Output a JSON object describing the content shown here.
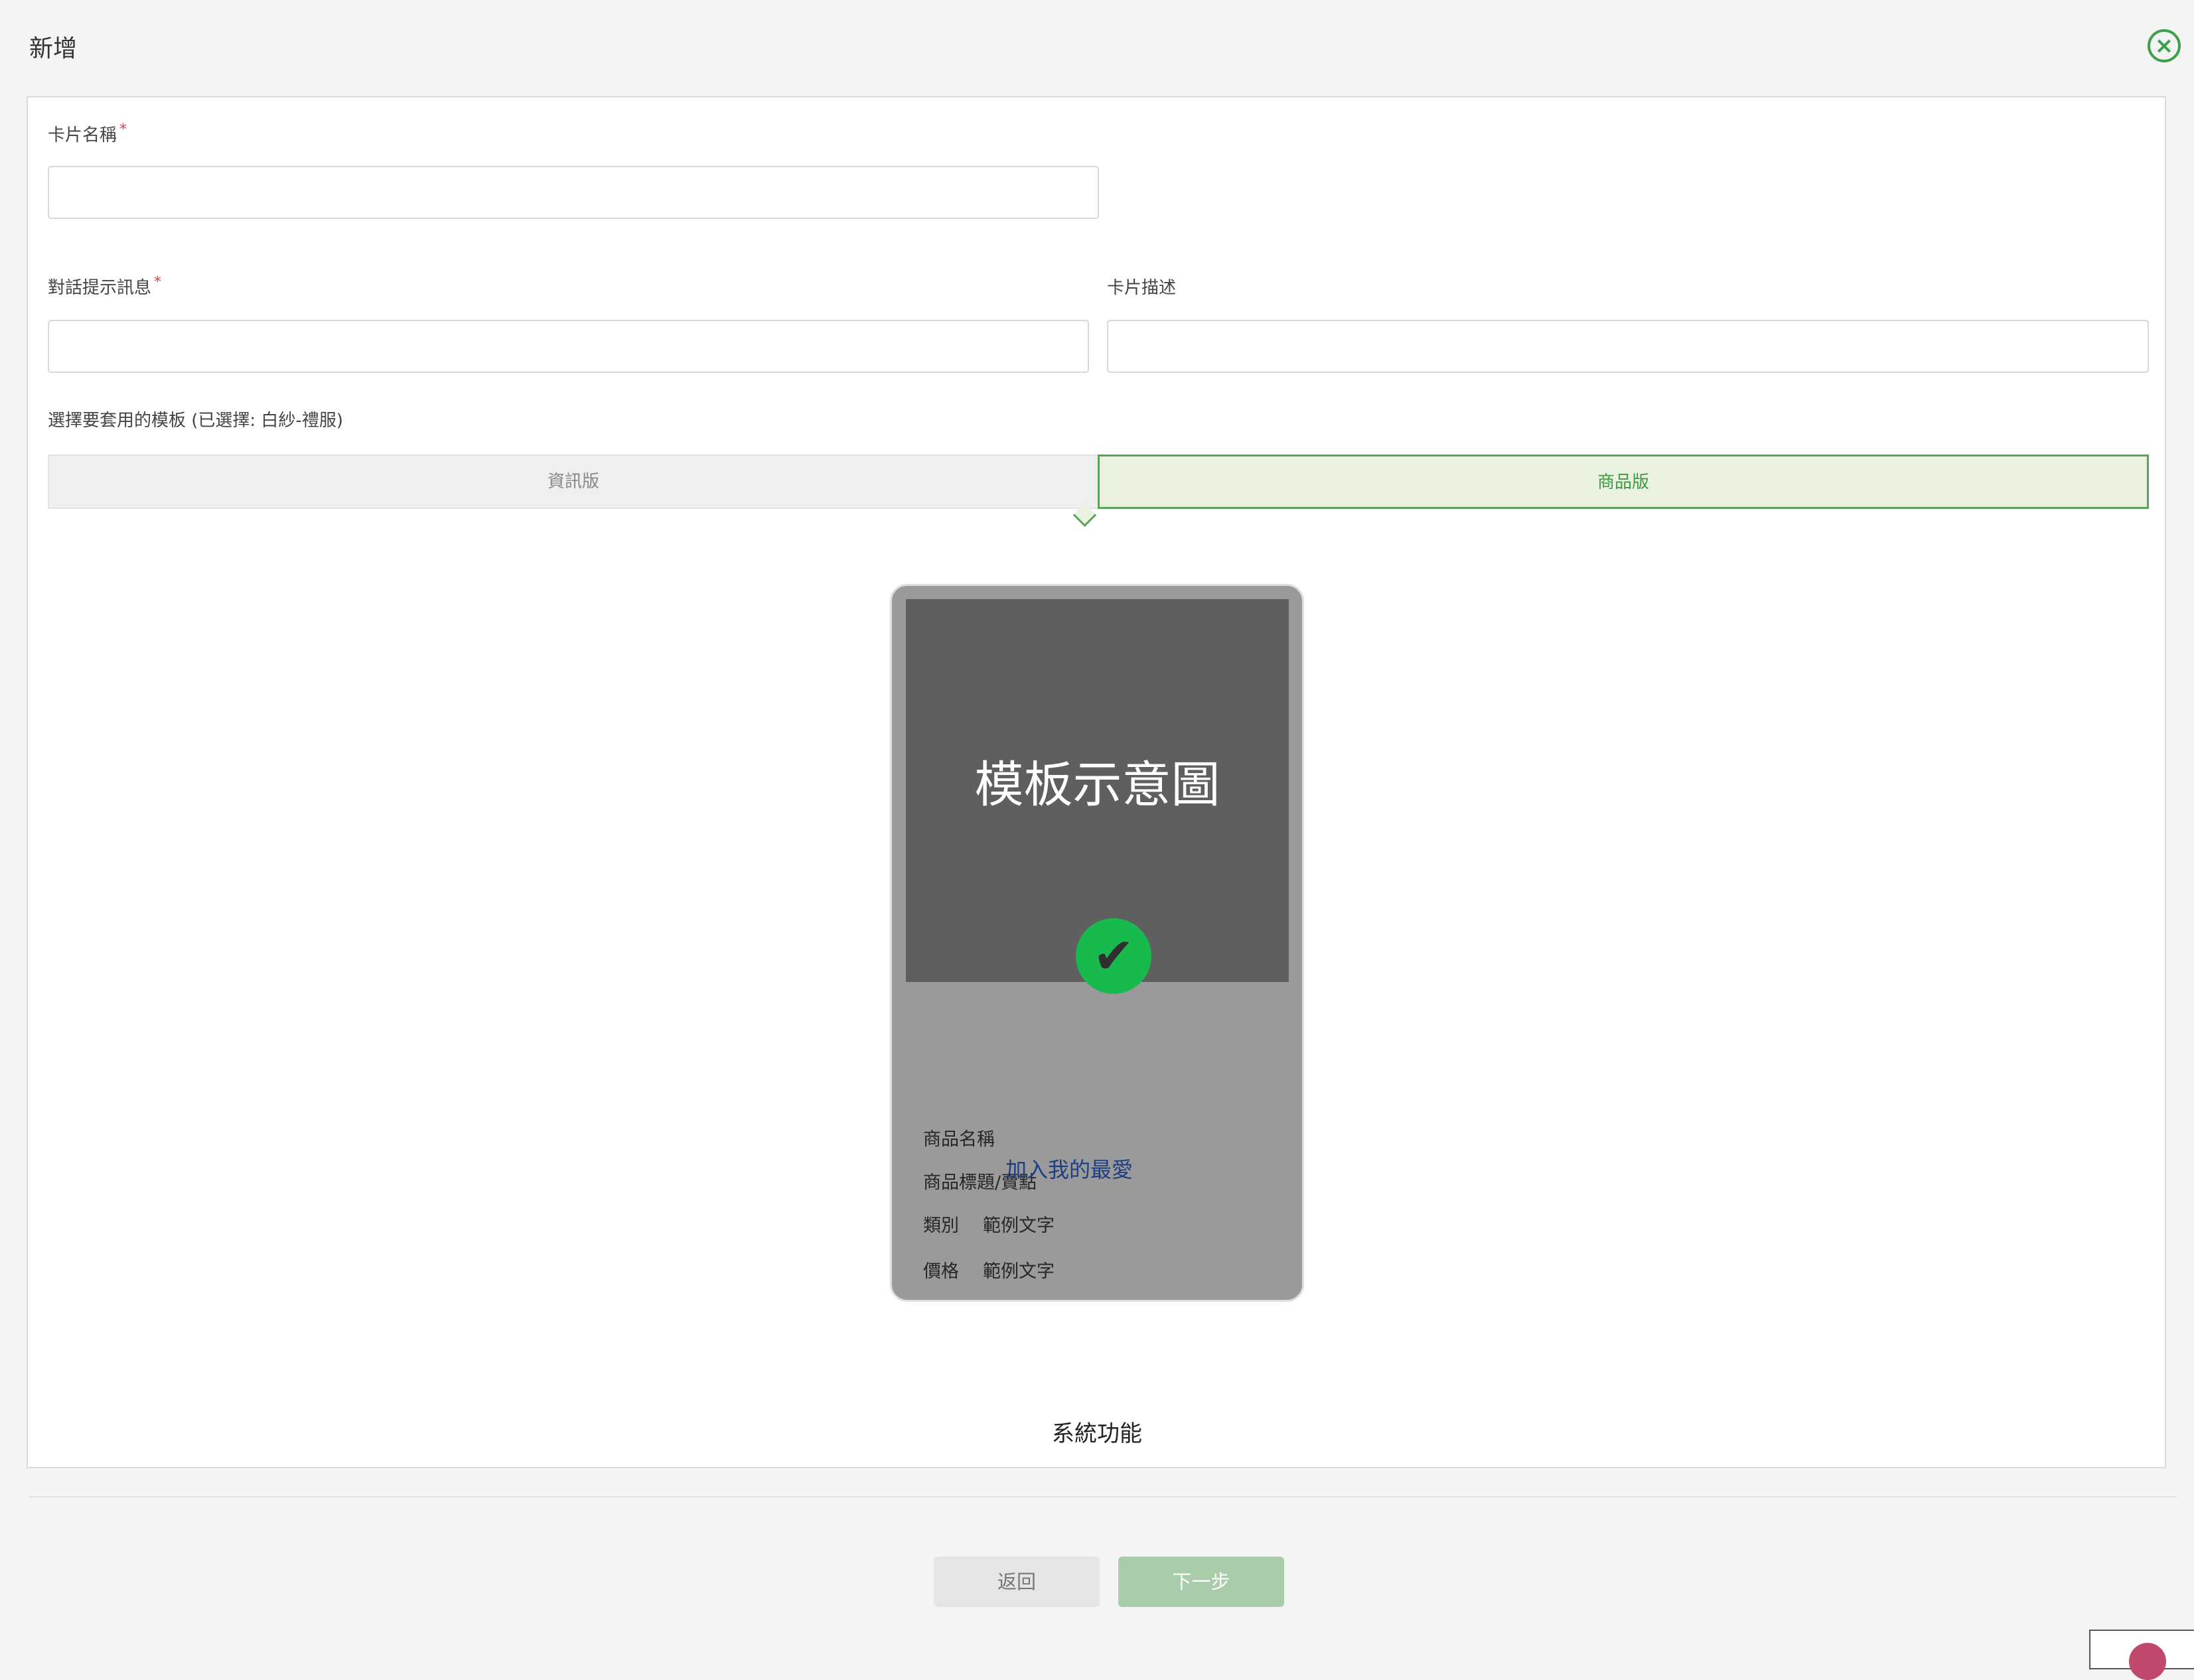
{
  "header": {
    "title": "新增",
    "close_icon": "close-circle-icon"
  },
  "form": {
    "card_name": {
      "label": "卡片名稱",
      "required_mark": "*",
      "value": "",
      "placeholder": ""
    },
    "chat_prompt": {
      "label": "對話提示訊息",
      "required_mark": "*",
      "value": "",
      "placeholder": ""
    },
    "card_desc": {
      "label": "卡片描述",
      "value": "",
      "placeholder": ""
    },
    "template_prompt": "選擇要套用的模板 (已選擇: 白紗-禮服)"
  },
  "tabs": [
    {
      "label": "資訊版",
      "selected": false
    },
    {
      "label": "商品版",
      "selected": true
    }
  ],
  "template_card": {
    "image_text": "模板示意圖",
    "check_icon": "check-circle-icon",
    "product_name": "商品名稱",
    "product_title": "商品標題/賣點",
    "category_label": "類別",
    "category_value": "範例文字",
    "price_label": "價格",
    "price_value": "範例文字",
    "favorite_label": "加入我的最愛",
    "caption": "系統功能"
  },
  "footer": {
    "back_label": "返回",
    "next_label": "下一步"
  },
  "colors": {
    "accent": "#3aa04a",
    "check": "#18b94d",
    "selected_tab_bg": "#eaf2df",
    "next_button": "#a9ccaa"
  }
}
